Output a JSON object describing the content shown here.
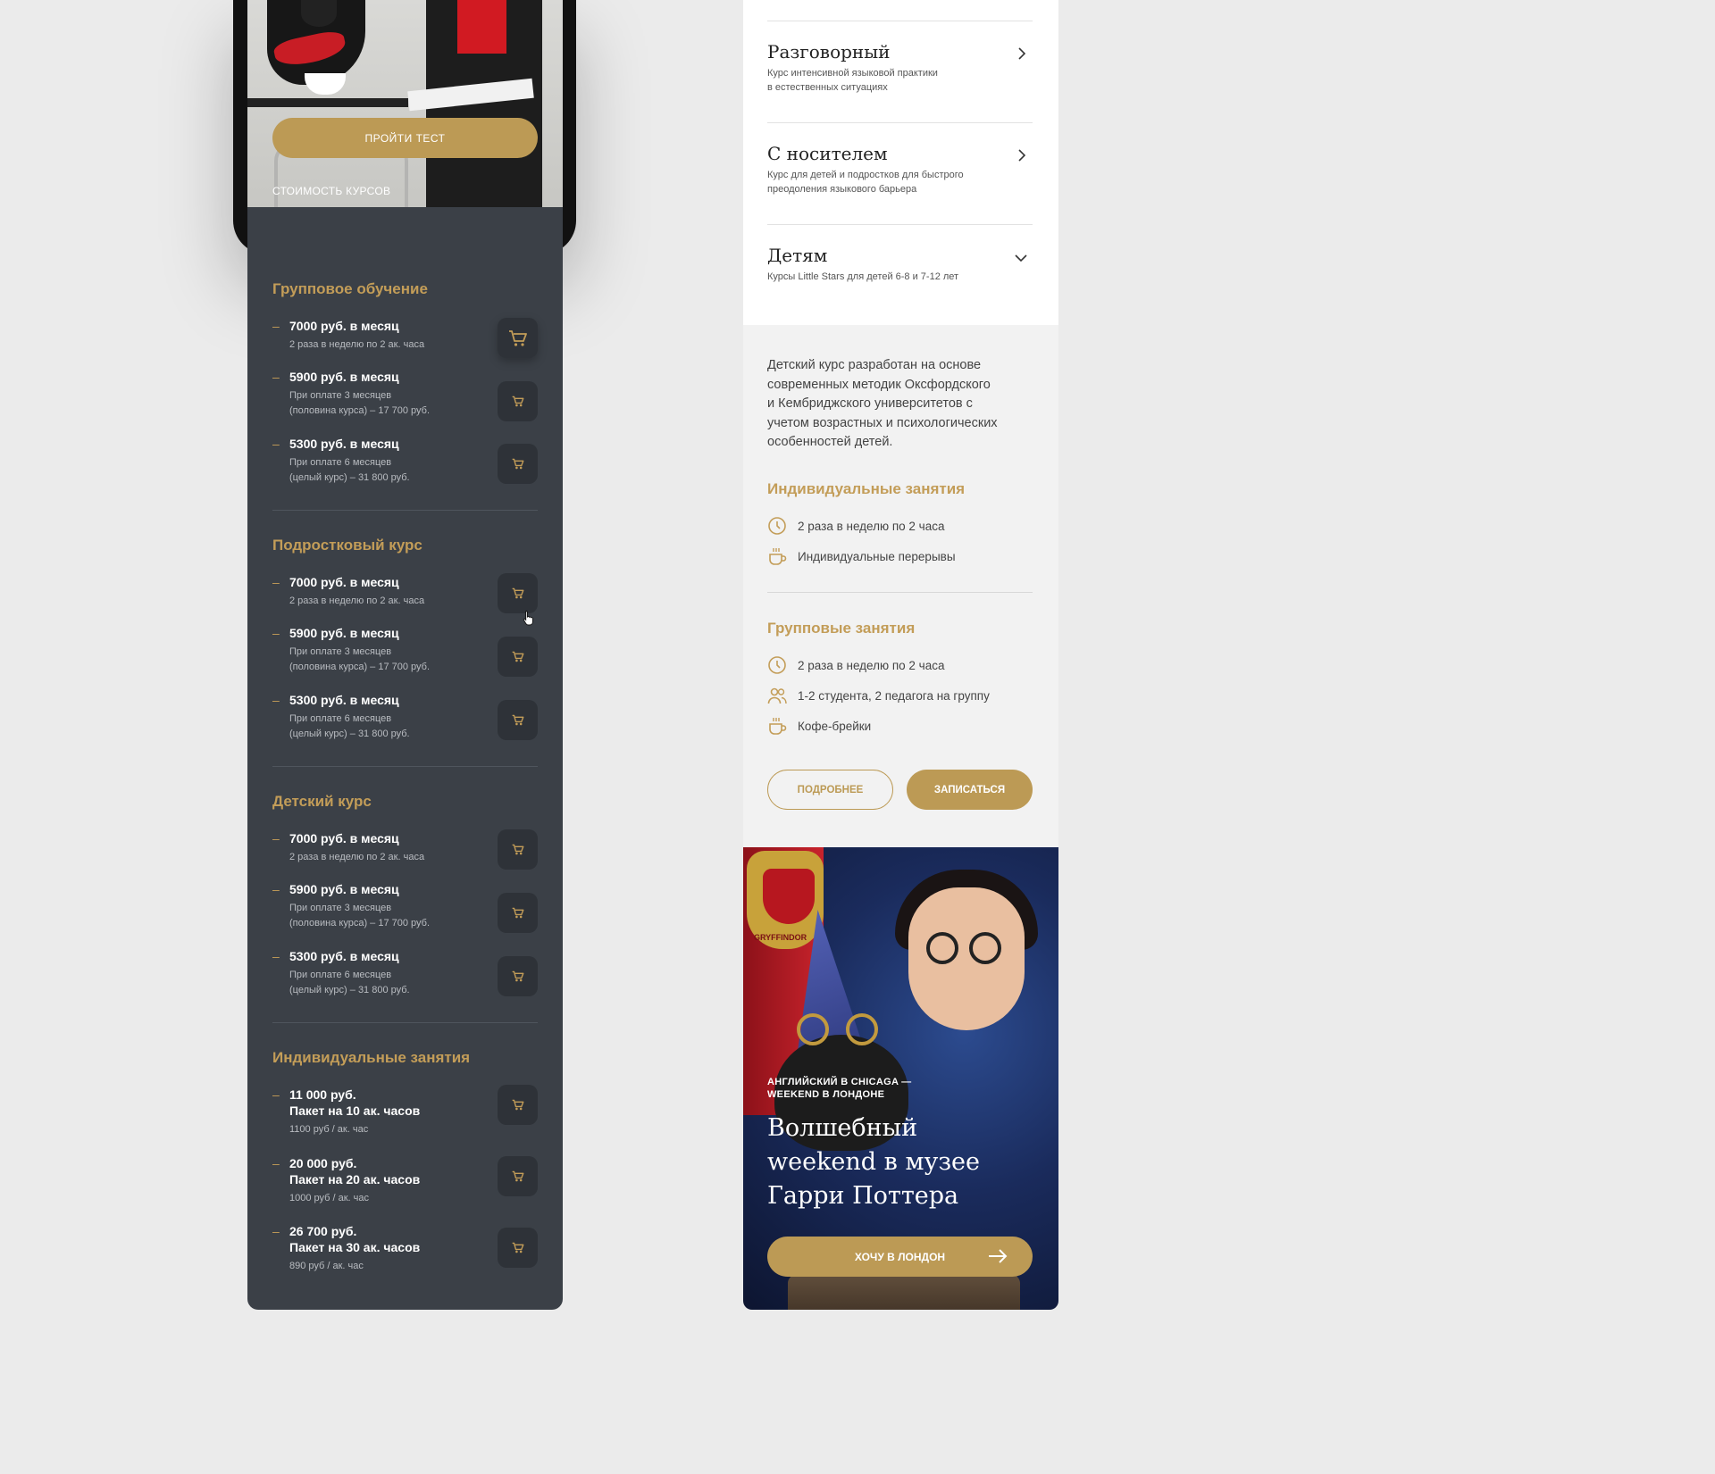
{
  "hero": {
    "test_button": "ПРОЙТИ ТЕСТ",
    "cost_label": "СТОИМОСТЬ КУРСОВ"
  },
  "pricing": [
    {
      "title": "Групповое обучение",
      "items": [
        {
          "price": "7000 руб. в месяц",
          "note": "2 раза в неделю по 2 ак. часа"
        },
        {
          "price": "5900 руб. в месяц",
          "note": "При оплате 3 месяцев",
          "note2": "(половина курса) – 17 700 руб."
        },
        {
          "price": "5300 руб. в месяц",
          "note": "При оплате 6 месяцев",
          "note2": "(целый курс) – 31 800 руб."
        }
      ]
    },
    {
      "title": "Подростковый курс",
      "items": [
        {
          "price": "7000 руб. в месяц",
          "note": "2 раза в неделю по 2 ак. часа"
        },
        {
          "price": "5900 руб. в месяц",
          "note": "При оплате 3 месяцев",
          "note2": "(половина курса) – 17 700 руб."
        },
        {
          "price": "5300 руб. в месяц",
          "note": "При оплате 6 месяцев",
          "note2": "(целый курс) – 31 800 руб."
        }
      ]
    },
    {
      "title": "Детский курс",
      "items": [
        {
          "price": "7000 руб. в месяц",
          "note": "2 раза в неделю по 2 ак. часа"
        },
        {
          "price": "5900 руб. в месяц",
          "note": "При оплате 3 месяцев",
          "note2": "(половина курса) – 17 700 руб."
        },
        {
          "price": "5300 руб. в месяц",
          "note": "При оплате 6 месяцев",
          "note2": "(целый курс) – 31 800 руб."
        }
      ]
    },
    {
      "title": "Индивидуальные занятия",
      "items": [
        {
          "price": "11 000 руб.",
          "price2": "Пакет на 10 ак. часов",
          "note": "1100 руб / ак. час"
        },
        {
          "price": "20 000 руб.",
          "price2": "Пакет на 20 ак. часов",
          "note": "1000 руб / ак. час"
        },
        {
          "price": "26 700 руб.",
          "price2": "Пакет на 30 ак. часов",
          "note": "890 руб / ак. час"
        }
      ]
    }
  ],
  "accordion": [
    {
      "title": "Разговорный",
      "sub1": "Курс интенсивной языковой практики",
      "sub2": "в естественных ситуациях",
      "icon": "chevron-right-icon"
    },
    {
      "title": "С носителем",
      "sub1": "Курс для детей и подростков для быстрого",
      "sub2": "преодоления языкового барьера",
      "icon": "chevron-right-icon"
    },
    {
      "title": "Детям",
      "sub1": "Курсы Little Stars для детей 6-8 и 7-12 лет",
      "sub2": "",
      "icon": "chevron-down-icon"
    }
  ],
  "kids_detail": {
    "desc": [
      "Детский курс разработан на основе",
      "современных методик Оксфордского",
      "и Кембриджского университетов с",
      "учетом возрастных и психологических",
      "особенностей детей."
    ],
    "individual_title": "Индивидуальные занятия",
    "individual_features": [
      {
        "icon": "clock-icon",
        "text": "2 раза в неделю по 2 часа"
      },
      {
        "icon": "coffee-cup-icon",
        "text": "Индивидуальные перерывы"
      }
    ],
    "group_title": "Групповые занятия",
    "group_features": [
      {
        "icon": "clock-icon",
        "text": "2 раза в неделю по 2 часа"
      },
      {
        "icon": "users-icon",
        "text": "1-2 студента, 2 педагога на группу"
      },
      {
        "icon": "coffee-cup-icon",
        "text": "Кофе-брейки"
      }
    ],
    "more_button": "ПОДРОБНЕЕ",
    "enroll_button": "ЗАПИСАТЬСЯ"
  },
  "promo": {
    "crest_text": "GRYFFINDOR",
    "kicker1": "АНГЛИЙСКИЙ В CHICAGA —",
    "kicker2": "WEEKEND В ЛОНДОНЕ",
    "title1": "Волшебный",
    "title2": "weekend в музее",
    "title3": "Гарри Поттера",
    "button": "ХОЧУ В ЛОНДОН"
  },
  "colors": {
    "accent": "#bc9a55",
    "panel": "#3b4047",
    "page": "#ebebeb"
  }
}
